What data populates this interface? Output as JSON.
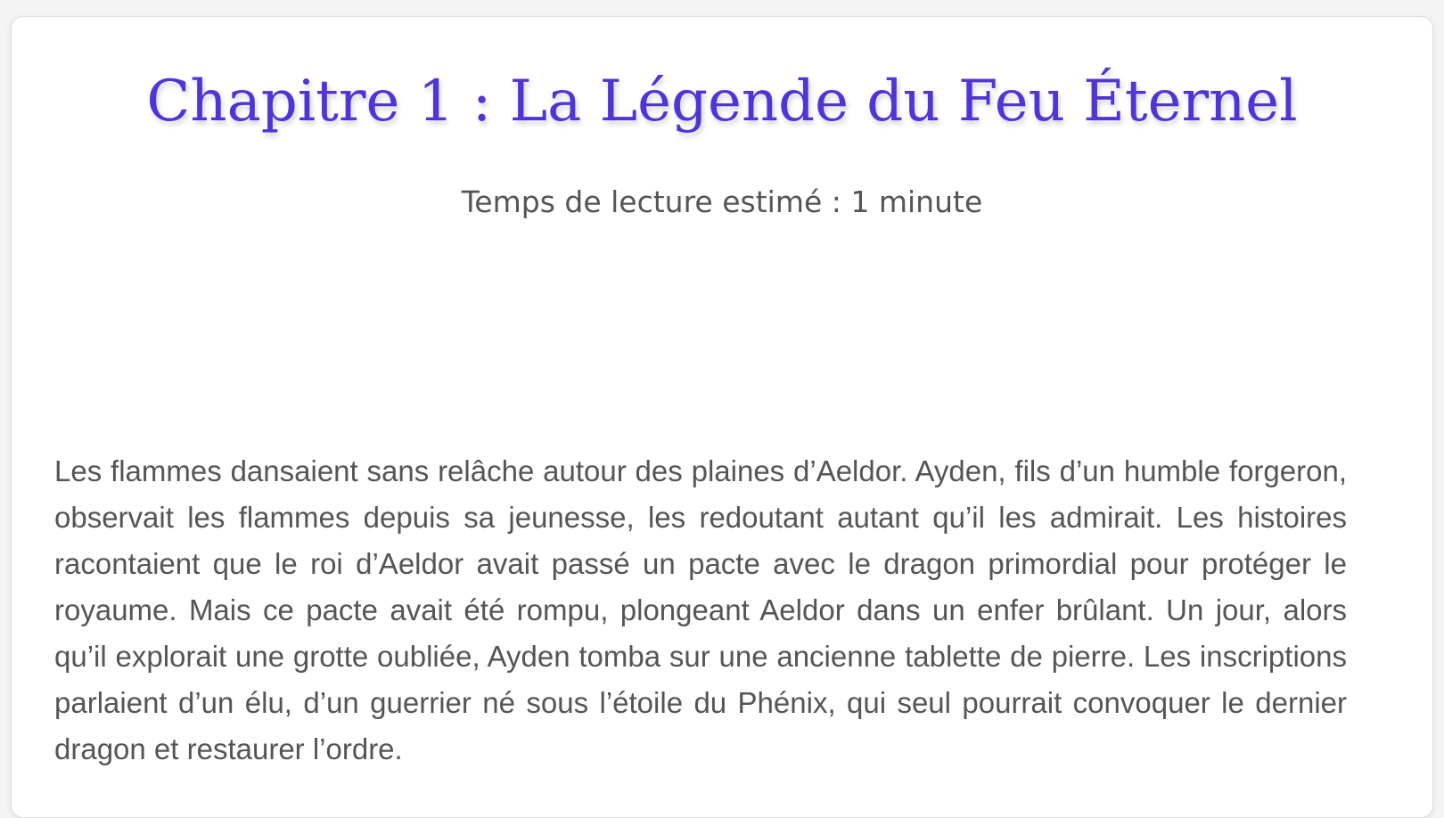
{
  "chapter": {
    "title": "Chapitre 1 : La Légende du Feu Éternel",
    "reading_time": "Temps de lecture estimé : 1 minute",
    "body": "Les flammes dansaient sans relâche autour des plaines d’Aeldor. Ayden, fils d’un humble forgeron, observait les flammes depuis sa jeunesse, les redoutant autant qu’il les admirait. Les histoires racontaient que le roi d’Aeldor avait passé un pacte avec le dragon primordial pour protéger le royaume. Mais ce pacte avait été rompu, plongeant Aeldor dans un enfer brûlant. Un jour, alors qu’il explorait une grotte oubliée, Ayden tomba sur une ancienne tablette de pierre. Les inscriptions parlaient d’un élu, d’un guerrier né sous l’étoile du Phénix, qui seul pourrait convoquer le dernier dragon et restaurer l’ordre."
  },
  "colors": {
    "title": "#5133d6",
    "text": "#555555",
    "background": "#ffffff"
  }
}
